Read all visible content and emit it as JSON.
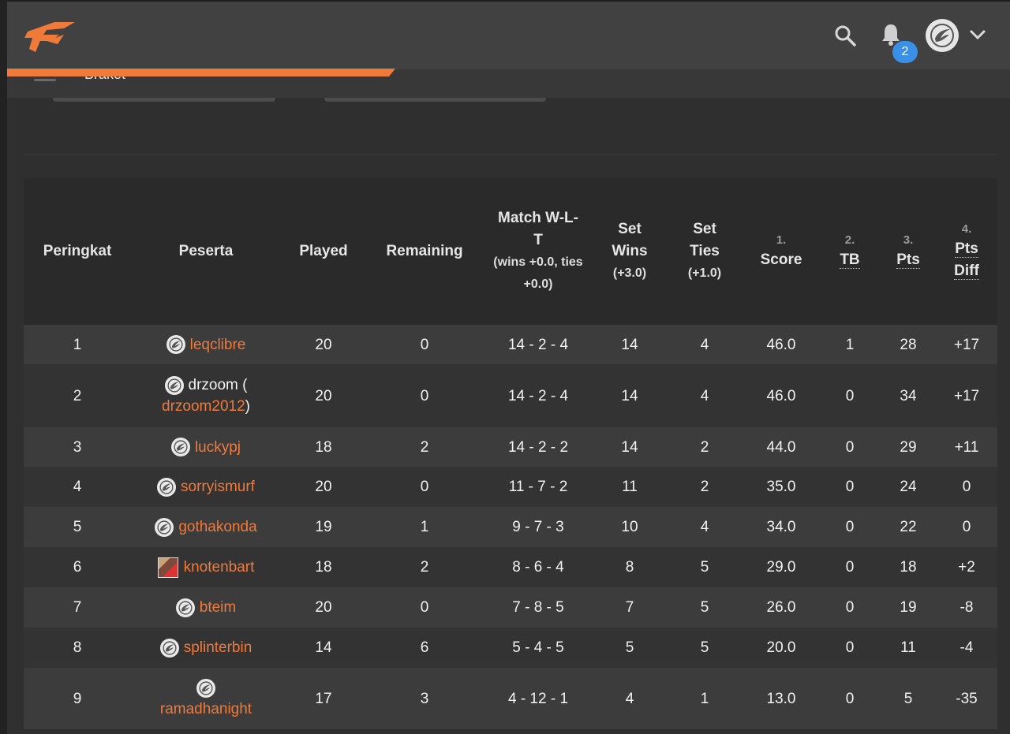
{
  "header": {
    "notification_count": "2",
    "logo_icon": "flame-brand-logo",
    "icons": [
      "search-icon",
      "bell-icon",
      "chevron-down-icon"
    ],
    "colors": {
      "accent": "#f07a3a",
      "badge": "#3a8fe6"
    }
  },
  "subbar": {
    "breadcrumb": "Braket"
  },
  "table": {
    "headers": {
      "rank": "Peringkat",
      "participant": "Peserta",
      "played": "Played",
      "remaining": "Remaining",
      "match_wlt": "Match W-L-T",
      "match_wlt_sub": "(wins +0.0, ties +0.0)",
      "set_wins": "Set Wins",
      "set_wins_sub": "(+3.0)",
      "set_ties": "Set Ties",
      "set_ties_sub": "(+1.0)",
      "score_num": "1.",
      "score": "Score",
      "tb_num": "2.",
      "tb": "TB",
      "pts_num": "3.",
      "pts": "Pts",
      "pts_diff_num": "4.",
      "pts_diff": "Pts Diff"
    },
    "rows": [
      {
        "rank": "1",
        "name": "leqclibre",
        "avatar": "logo",
        "played": "20",
        "remaining": "0",
        "wlt": "14 - 2 - 4",
        "set_wins": "14",
        "set_ties": "4",
        "score": "46.0",
        "tb": "1",
        "pts": "28",
        "diff": "+17"
      },
      {
        "rank": "2",
        "prefix": "drzoom (",
        "name": "drzoom2012",
        "suffix": ")",
        "avatar": "logo",
        "played": "20",
        "remaining": "0",
        "wlt": "14 - 2 - 4",
        "set_wins": "14",
        "set_ties": "4",
        "score": "46.0",
        "tb": "0",
        "pts": "34",
        "diff": "+17"
      },
      {
        "rank": "3",
        "name": "luckypj",
        "avatar": "logo",
        "played": "18",
        "remaining": "2",
        "wlt": "14 - 2 - 2",
        "set_wins": "14",
        "set_ties": "2",
        "score": "44.0",
        "tb": "0",
        "pts": "29",
        "diff": "+11"
      },
      {
        "rank": "4",
        "name": "sorryismurf",
        "avatar": "logo",
        "played": "20",
        "remaining": "0",
        "wlt": "11 - 7 - 2",
        "set_wins": "11",
        "set_ties": "2",
        "score": "35.0",
        "tb": "0",
        "pts": "24",
        "diff": "0"
      },
      {
        "rank": "5",
        "name": "gothakonda",
        "avatar": "logo",
        "played": "19",
        "remaining": "1",
        "wlt": "9 - 7 - 3",
        "set_wins": "10",
        "set_ties": "4",
        "score": "34.0",
        "tb": "0",
        "pts": "22",
        "diff": "0"
      },
      {
        "rank": "6",
        "name": "knotenbart",
        "avatar": "photo",
        "played": "18",
        "remaining": "2",
        "wlt": "8 - 6 - 4",
        "set_wins": "8",
        "set_ties": "5",
        "score": "29.0",
        "tb": "0",
        "pts": "18",
        "diff": "+2"
      },
      {
        "rank": "7",
        "name": "bteim",
        "avatar": "logo",
        "played": "20",
        "remaining": "0",
        "wlt": "7 - 8 - 5",
        "set_wins": "7",
        "set_ties": "5",
        "score": "26.0",
        "tb": "0",
        "pts": "19",
        "diff": "-8"
      },
      {
        "rank": "8",
        "name": "splinterbin",
        "avatar": "logo",
        "played": "14",
        "remaining": "6",
        "wlt": "5 - 4 - 5",
        "set_wins": "5",
        "set_ties": "5",
        "score": "20.0",
        "tb": "0",
        "pts": "11",
        "diff": "-4"
      },
      {
        "rank": "9",
        "name": "ramadhanight",
        "avatar": "logo",
        "stacked": true,
        "played": "17",
        "remaining": "3",
        "wlt": "4 - 12 - 1",
        "set_wins": "4",
        "set_ties": "1",
        "score": "13.0",
        "tb": "0",
        "pts": "5",
        "diff": "-35"
      }
    ]
  }
}
